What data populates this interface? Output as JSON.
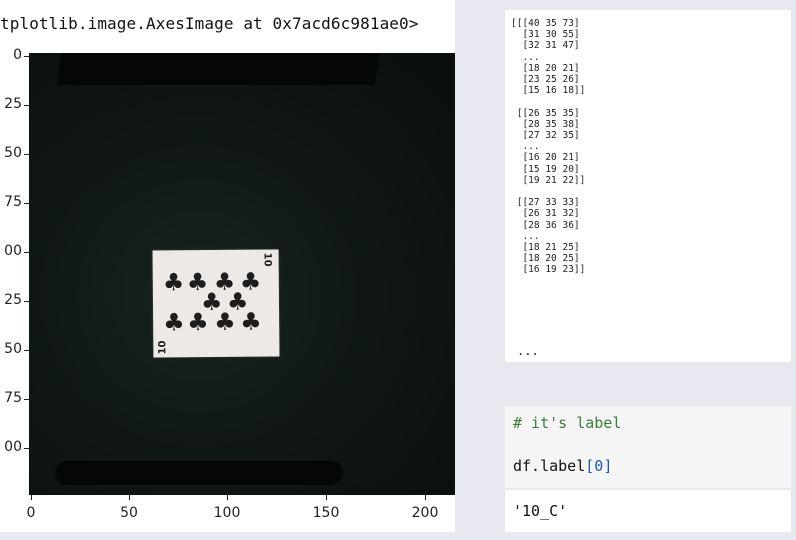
{
  "plot_output": {
    "repr": "tplotlib.image.AxesImage at 0x7acd6c981ae0>",
    "y_ticks": [
      "0",
      "25",
      "50",
      "75",
      "00",
      "25",
      "50",
      "75",
      "00"
    ],
    "x_ticks": [
      "0",
      "50",
      "100",
      "150",
      "200"
    ],
    "card": {
      "top_right_corner": "10",
      "bottom_left_corner": "10",
      "suit_symbol": "♣"
    }
  },
  "array_output": {
    "text": "[[[40 35 73]\n  [31 30 55]\n  [32 31 47]\n  ...\n  [18 20 21]\n  [23 25 26]\n  [15 16 18]]\n\n [[26 35 35]\n  [28 35 38]\n  [27 32 35]\n  ...\n  [16 20 21]\n  [15 19 20]\n  [19 21 22]]\n\n [[27 33 33]\n  [26 31 32]\n  [28 36 36]\n  ...\n  [18 21 25]\n  [18 20 25]\n  [16 19 23]]",
    "ellipsis": "..."
  },
  "code_cell": {
    "comment": "# it's label",
    "code_prefix": "df.label",
    "bracket_open": "[",
    "index": "0",
    "bracket_close": "]"
  },
  "output_cell": {
    "value": "'10_C'"
  },
  "colors": {
    "background": "#e8e8f0",
    "comment_green": "#3b7d3b",
    "bracket_blue": "#1a57b8"
  }
}
